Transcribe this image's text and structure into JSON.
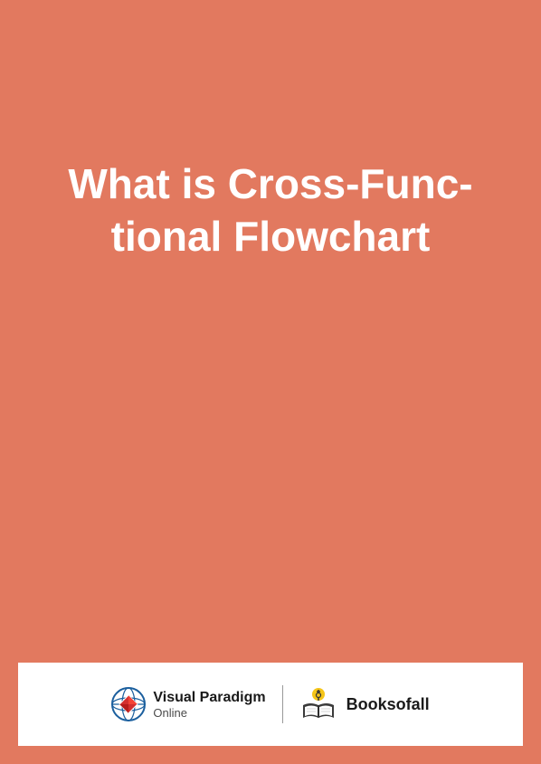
{
  "title": "What is Cross-Func-\ntional Flowchart",
  "title_line1": "What is Cross-Func-",
  "title_line2": "tional Flowchart",
  "footer": {
    "brand_left": {
      "name_main": "Visual Paradigm",
      "name_sub": "Online"
    },
    "brand_right": {
      "name": "Booksofall"
    }
  },
  "colors": {
    "background": "#e2795f",
    "title_text": "#ffffff",
    "footer_bg": "#ffffff"
  }
}
